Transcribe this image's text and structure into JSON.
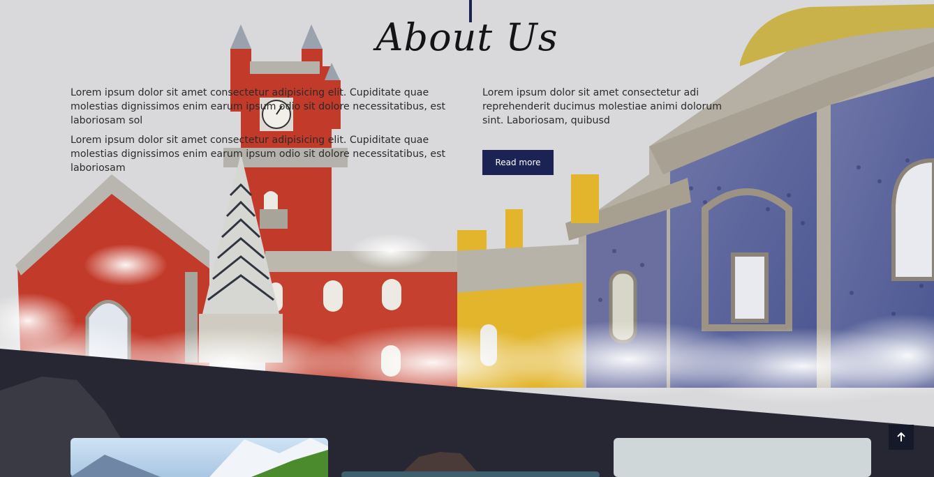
{
  "section": {
    "title": "About Us",
    "paragraphs": [
      "Lorem ipsum dolor sit amet consectetur adipisicing elit. Cupiditate quae molestias dignissimos enim earum ipsum odio sit dolore necessitatibus, est laboriosam sol",
      "Lorem ipsum dolor sit amet consectetur adipisicing elit. Cupiditate quae molestias dignissimos enim earum ipsum odio sit dolore necessitatibus, est laboriosam",
      "Lorem ipsum dolor sit amet consectetur adi reprehenderit ducimus molestiae animi dolorum sint. Laboriosam, quibusd"
    ],
    "read_more_label": "Read more"
  },
  "colors": {
    "accent": "#1a2353",
    "dark_section": "#272734",
    "background": "#d9d9db"
  },
  "icons": {
    "scroll_top": "arrow-up-icon"
  }
}
